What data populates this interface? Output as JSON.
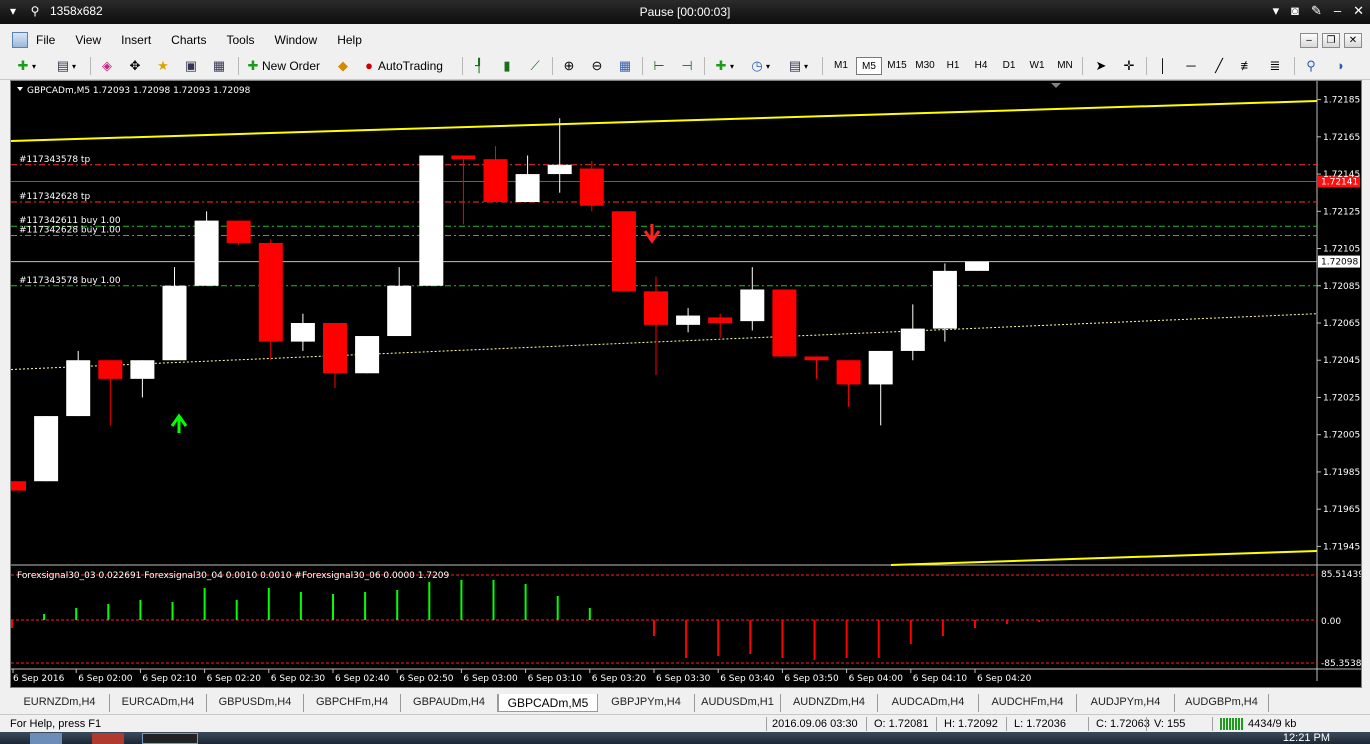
{
  "titlebar": {
    "resolution": "1358x682",
    "title": "Pause [00:00:03]"
  },
  "menu": [
    "File",
    "View",
    "Insert",
    "Charts",
    "Tools",
    "Window",
    "Help"
  ],
  "toolbar": {
    "new_order": "New Order",
    "autotrading": "AutoTrading",
    "timeframes": [
      "M1",
      "M5",
      "M15",
      "M30",
      "H1",
      "H4",
      "D1",
      "W1",
      "MN"
    ],
    "active_timeframe": "M5"
  },
  "chart": {
    "header": "GBPCADm,M5  1.72093 1.72098 1.72093 1.72098",
    "current_price": "1.72098",
    "ask_price": "1.72141",
    "price_labels": [
      {
        "text": "1.72185",
        "p": 1.72185
      },
      {
        "text": "1.72165",
        "p": 1.72165
      },
      {
        "text": "1.72145",
        "p": 1.72145
      },
      {
        "text": "1.72125",
        "p": 1.72125
      },
      {
        "text": "1.72105",
        "p": 1.72105
      },
      {
        "text": "1.72085",
        "p": 1.72085
      },
      {
        "text": "1.72065",
        "p": 1.72065
      },
      {
        "text": "1.72045",
        "p": 1.72045
      },
      {
        "text": "1.72025",
        "p": 1.72025
      },
      {
        "text": "1.72005",
        "p": 1.72005
      },
      {
        "text": "1.71985",
        "p": 1.71985
      },
      {
        "text": "1.71965",
        "p": 1.71965
      },
      {
        "text": "1.71945",
        "p": 1.71945
      }
    ],
    "order_labels": [
      {
        "text": "#117343578 tp",
        "p": 1.7215,
        "color": "#ff3030"
      },
      {
        "text": "#117342628 tp",
        "p": 1.7213,
        "color": "#ff3030"
      },
      {
        "text": "#117342611 buy 1.00",
        "p": 1.72117,
        "color": "#20c020"
      },
      {
        "text": "#117342628 buy 1.00",
        "p": 1.72112,
        "color": "#20c020"
      },
      {
        "text": "#117343578 buy 1.00",
        "p": 1.72085,
        "color": "#20c020"
      }
    ],
    "time_labels": [
      "6 Sep 2016",
      "6 Sep 02:00",
      "6 Sep 02:10",
      "6 Sep 02:20",
      "6 Sep 02:30",
      "6 Sep 02:40",
      "6 Sep 02:50",
      "6 Sep 03:00",
      "6 Sep 03:10",
      "6 Sep 03:20",
      "6 Sep 03:30",
      "6 Sep 03:40",
      "6 Sep 03:50",
      "6 Sep 04:00",
      "6 Sep 04:10",
      "6 Sep 04:20"
    ],
    "indicator_header": "Forexsignal30_03 0.022691  Forexsignal30_04 0.0010 0.0010  #Forexsignal30_06 0.0000 1.7209",
    "indicator_labels": [
      "85.514391",
      "0.00",
      "-85.353888"
    ],
    "colors": {
      "bull": "#ffffff",
      "bear": "#ff0000",
      "hist_up": "#00ff00",
      "hist_down": "#ff0000",
      "trend": "#ffff00",
      "ma": "#ffffa0"
    }
  },
  "chart_data": {
    "type": "candlestick",
    "title": "GBPCADm,M5",
    "ylim": [
      1.71935,
      1.72195
    ],
    "candles": [
      {
        "o": 1.7198,
        "h": 1.7198,
        "l": 1.71975,
        "c": 1.71975
      },
      {
        "o": 1.7198,
        "h": 1.72015,
        "l": 1.7198,
        "c": 1.72015
      },
      {
        "o": 1.72015,
        "h": 1.7205,
        "l": 1.72015,
        "c": 1.72045
      },
      {
        "o": 1.72045,
        "h": 1.72045,
        "l": 1.7201,
        "c": 1.72035
      },
      {
        "o": 1.72035,
        "h": 1.72045,
        "l": 1.72025,
        "c": 1.72045
      },
      {
        "o": 1.72045,
        "h": 1.72095,
        "l": 1.72045,
        "c": 1.72085
      },
      {
        "o": 1.72085,
        "h": 1.72125,
        "l": 1.72085,
        "c": 1.7212
      },
      {
        "o": 1.7212,
        "h": 1.7212,
        "l": 1.72107,
        "c": 1.72108
      },
      {
        "o": 1.72108,
        "h": 1.7211,
        "l": 1.72045,
        "c": 1.72055
      },
      {
        "o": 1.72055,
        "h": 1.7207,
        "l": 1.7205,
        "c": 1.72065
      },
      {
        "o": 1.72065,
        "h": 1.72065,
        "l": 1.7203,
        "c": 1.72038
      },
      {
        "o": 1.72038,
        "h": 1.72058,
        "l": 1.72038,
        "c": 1.72058
      },
      {
        "o": 1.72058,
        "h": 1.72095,
        "l": 1.72058,
        "c": 1.72085
      },
      {
        "o": 1.72085,
        "h": 1.72155,
        "l": 1.72085,
        "c": 1.72155
      },
      {
        "o": 1.72155,
        "h": 1.72155,
        "l": 1.72118,
        "c": 1.72153
      },
      {
        "o": 1.72153,
        "h": 1.7216,
        "l": 1.7213,
        "c": 1.7213
      },
      {
        "o": 1.7213,
        "h": 1.72155,
        "l": 1.7213,
        "c": 1.72145
      },
      {
        "o": 1.72145,
        "h": 1.72175,
        "l": 1.72135,
        "c": 1.7215
      },
      {
        "o": 1.72148,
        "h": 1.72152,
        "l": 1.72125,
        "c": 1.72128
      },
      {
        "o": 1.72125,
        "h": 1.72125,
        "l": 1.72082,
        "c": 1.72082
      },
      {
        "o": 1.72082,
        "h": 1.7209,
        "l": 1.72037,
        "c": 1.72064
      },
      {
        "o": 1.72064,
        "h": 1.72073,
        "l": 1.7206,
        "c": 1.72069
      },
      {
        "o": 1.72068,
        "h": 1.7207,
        "l": 1.72057,
        "c": 1.72065
      },
      {
        "o": 1.72066,
        "h": 1.72095,
        "l": 1.72061,
        "c": 1.72083
      },
      {
        "o": 1.72083,
        "h": 1.72083,
        "l": 1.72047,
        "c": 1.72047
      },
      {
        "o": 1.72047,
        "h": 1.72047,
        "l": 1.72035,
        "c": 1.72045
      },
      {
        "o": 1.72045,
        "h": 1.72045,
        "l": 1.7202,
        "c": 1.72032
      },
      {
        "o": 1.72032,
        "h": 1.7205,
        "l": 1.7201,
        "c": 1.7205
      },
      {
        "o": 1.7205,
        "h": 1.72075,
        "l": 1.72045,
        "c": 1.72062
      },
      {
        "o": 1.72062,
        "h": 1.72097,
        "l": 1.72055,
        "c": 1.72093
      },
      {
        "o": 1.72093,
        "h": 1.72098,
        "l": 1.72093,
        "c": 1.72098
      }
    ],
    "histogram": [
      -0.4,
      0.3,
      0.6,
      0.8,
      1.0,
      0.9,
      1.6,
      1.0,
      1.6,
      1.4,
      1.3,
      1.4,
      1.5,
      1.9,
      2.0,
      2.0,
      1.8,
      1.2,
      0.6,
      -0.02,
      -0.8,
      -1.9,
      -1.8,
      -1.7,
      -1.9,
      -2.0,
      -1.9,
      -1.9,
      -1.2,
      -0.8,
      -0.4,
      -0.2,
      -0.1
    ]
  },
  "tabs": [
    "EURNZDm,H4",
    "EURCADm,H4",
    "GBPUSDm,H4",
    "GBPCHFm,H4",
    "GBPAUDm,H4",
    "GBPCADm,M5",
    "GBPJPYm,H4",
    "AUDUSDm,H1",
    "AUDNZDm,H4",
    "AUDCADm,H4",
    "AUDCHFm,H4",
    "AUDJPYm,H4",
    "AUDGBPm,H4"
  ],
  "active_tab": "GBPCADm,M5",
  "status": {
    "help": "For Help, press F1",
    "datetime": "2016.09.06 03:30",
    "open": "O: 1.72081",
    "high": "H: 1.72092",
    "low": "L: 1.72036",
    "close": "C: 1.72063",
    "volume": "V: 155",
    "traffic": "4434/9 kb"
  },
  "taskbar": {
    "clock": "12:21 PM"
  }
}
